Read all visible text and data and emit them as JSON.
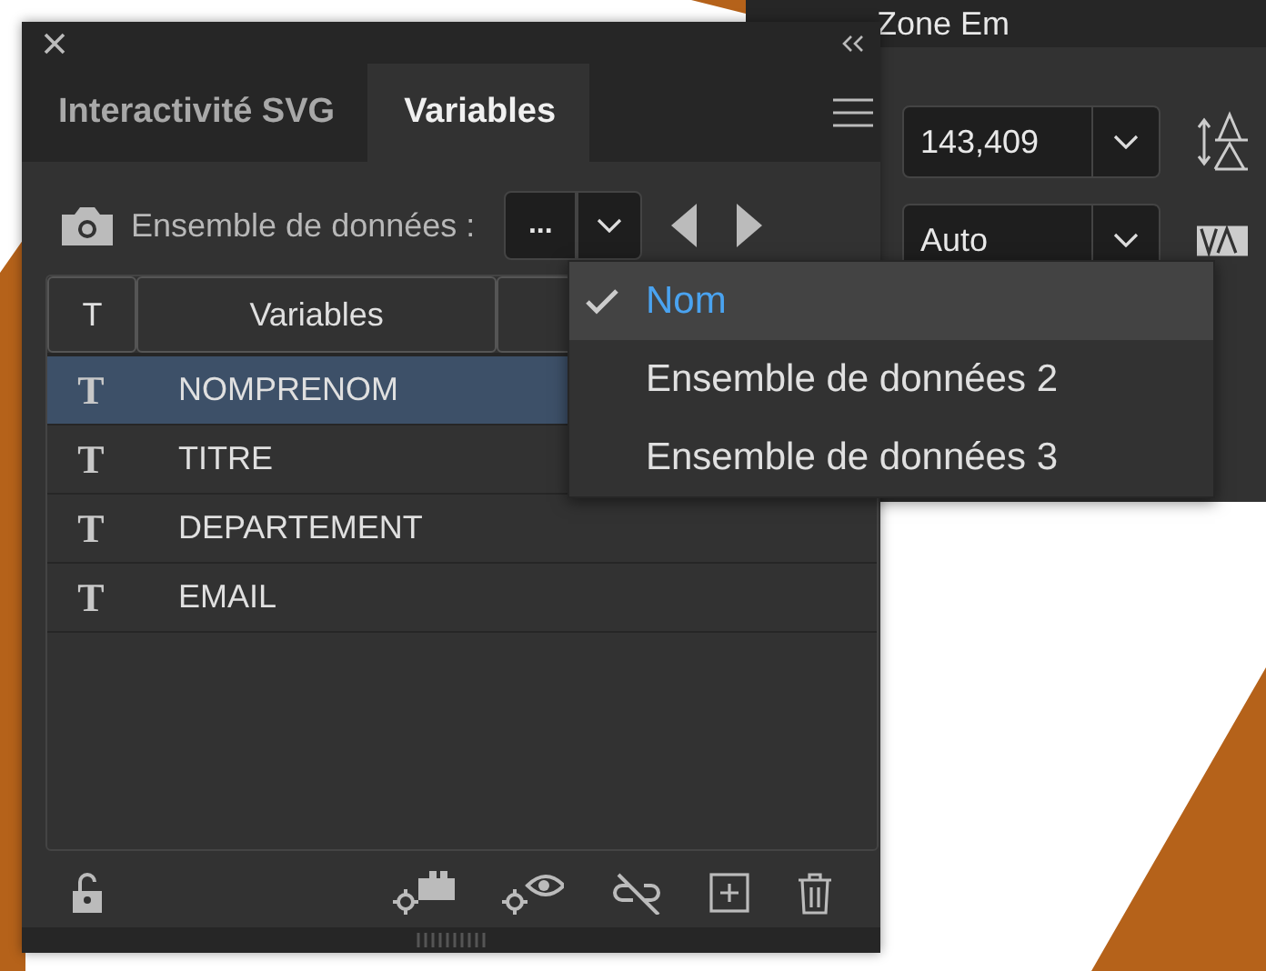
{
  "back_panel": {
    "title": "Zone Em",
    "leading": "143,409",
    "tracking": "Auto"
  },
  "panel": {
    "tabs": [
      {
        "label": "Interactivité SVG",
        "selected": false
      },
      {
        "label": "Variables",
        "selected": true
      }
    ],
    "dataset_label": "Ensemble de données :",
    "dataset_value": "...",
    "table": {
      "columns": [
        "T",
        "Variables"
      ],
      "rows": [
        {
          "type": "T",
          "name": "NOMPRENOM",
          "selected": true
        },
        {
          "type": "T",
          "name": "TITRE",
          "selected": false
        },
        {
          "type": "T",
          "name": "DEPARTEMENT",
          "selected": false
        },
        {
          "type": "T",
          "name": "EMAIL",
          "selected": false
        }
      ]
    }
  },
  "dropdown": {
    "items": [
      {
        "label": "Nom",
        "selected": true
      },
      {
        "label": "Ensemble de données 2",
        "selected": false
      },
      {
        "label": "Ensemble de données 3",
        "selected": false
      }
    ]
  }
}
